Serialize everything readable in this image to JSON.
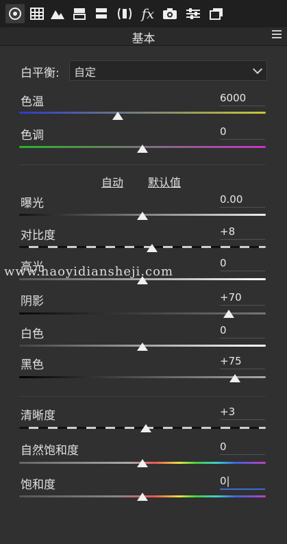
{
  "toolbar": {
    "icons": [
      "aperture-icon",
      "grid-icon",
      "mountain-icon",
      "split-icon",
      "half-icon",
      "lens-icon",
      "fx-icon",
      "camera-icon",
      "sliders-icon",
      "layers-icon"
    ],
    "fx_label": "fx"
  },
  "panel": {
    "title": "基本"
  },
  "white_balance": {
    "label": "白平衡:",
    "selected": "自定"
  },
  "sliders": [
    {
      "id": "temperature",
      "label": "色温",
      "value": "6000",
      "position": 0.4
    },
    {
      "id": "tint",
      "label": "色调",
      "value": "0",
      "position": 0.5
    },
    {
      "id": "exposure",
      "label": "曝光",
      "value": "0.00",
      "position": 0.5
    },
    {
      "id": "contrast",
      "label": "对比度",
      "value": "+8",
      "position": 0.54
    },
    {
      "id": "highlights",
      "label": "高光",
      "value": "0",
      "position": 0.5
    },
    {
      "id": "shadows",
      "label": "阴影",
      "value": "+70",
      "position": 0.85
    },
    {
      "id": "whites",
      "label": "白色",
      "value": "0",
      "position": 0.5
    },
    {
      "id": "blacks",
      "label": "黑色",
      "value": "+75",
      "position": 0.875
    },
    {
      "id": "clarity",
      "label": "清晰度",
      "value": "+3",
      "position": 0.515
    },
    {
      "id": "vibrance",
      "label": "自然饱和度",
      "value": "0",
      "position": 0.5
    },
    {
      "id": "saturation",
      "label": "饱和度",
      "value": "0|",
      "position": 0.5
    }
  ],
  "links": {
    "auto": "自动",
    "default": "默认值"
  },
  "watermark": "www.haoyidiansheji.com"
}
